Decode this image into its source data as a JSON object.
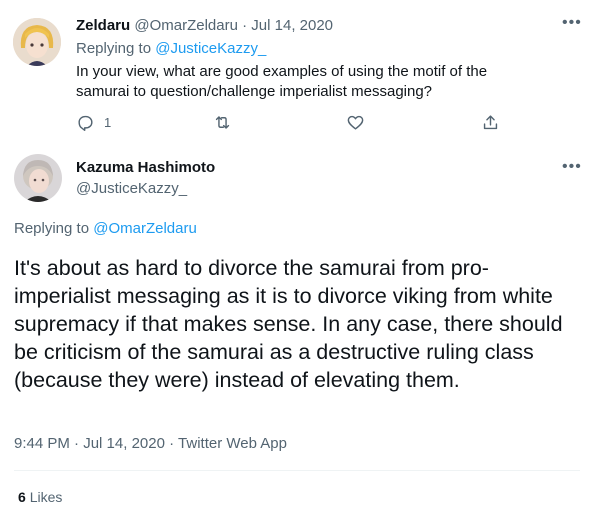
{
  "reply_tweet": {
    "name": "Zeldaru",
    "handle": "@OmarZeldaru",
    "separator": "·",
    "date": "Jul 14, 2020",
    "replying_prefix": "Replying to",
    "replying_to": "@JusticeKazzy_",
    "text": "In your view, what are good examples of using the motif of the samurai to question/challenge imperialist messaging?",
    "reply_count": "1",
    "icons": [
      "reply-icon",
      "retweet-icon",
      "like-icon",
      "share-icon",
      "more-icon"
    ]
  },
  "main_tweet": {
    "name": "Kazuma Hashimoto",
    "handle": "@JusticeKazzy_",
    "replying_prefix": "Replying to",
    "replying_to": "@OmarZeldaru",
    "text": "It's about as hard to divorce the samurai from pro-imperialist messaging as it is to divorce viking from white supremacy if that makes sense. In any case, there should be criticism of the samurai as a destructive ruling class (because they were) instead of elevating them.",
    "time": "9:44 PM",
    "separator": "·",
    "date": "Jul 14, 2020",
    "client": "Twitter Web App",
    "likes_count": "6",
    "likes_label": "Likes"
  },
  "colors": {
    "accent": "#1d9bf0",
    "text": "#0f1419",
    "muted": "#536471",
    "divider": "#eff3f4"
  }
}
